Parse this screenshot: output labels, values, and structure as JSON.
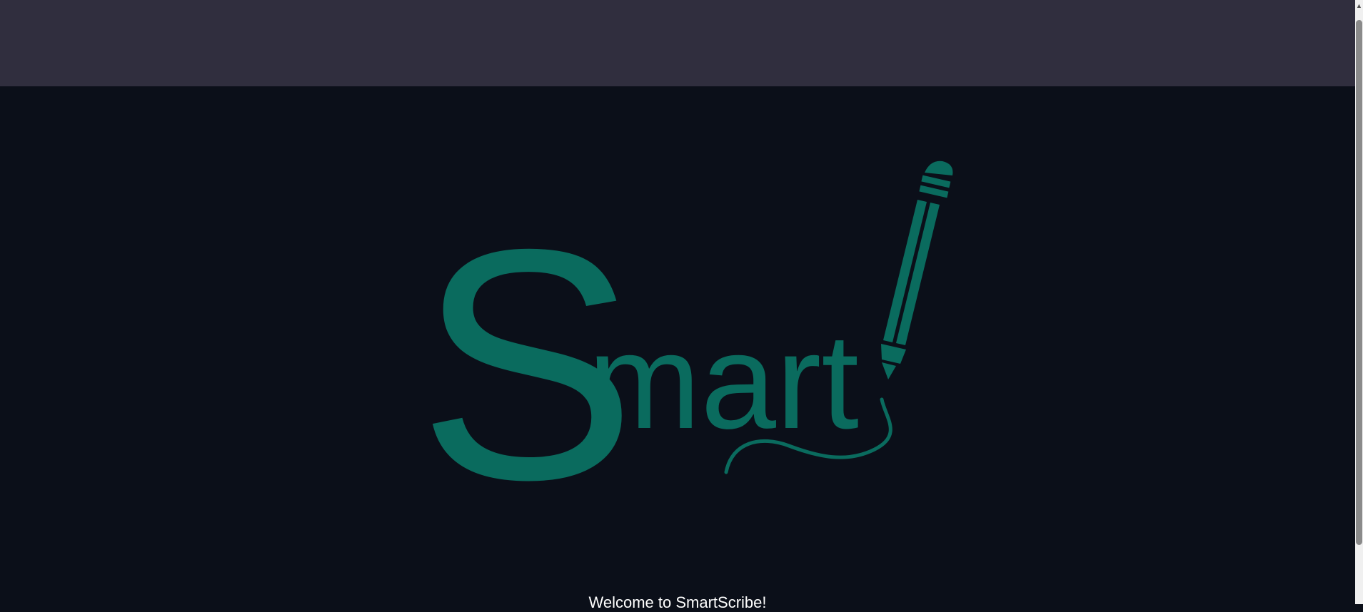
{
  "app": {
    "logo_text": "Smart",
    "welcome_message": "Welcome to SmartScribe!"
  },
  "colors": {
    "topbar": "#302e3e",
    "background": "#0b0f19",
    "brand_teal": "#0a6b5e",
    "text": "#ffffff"
  },
  "icons": {
    "logo_pen": "pencil-icon",
    "scroll_up": "chevron-up-icon"
  }
}
